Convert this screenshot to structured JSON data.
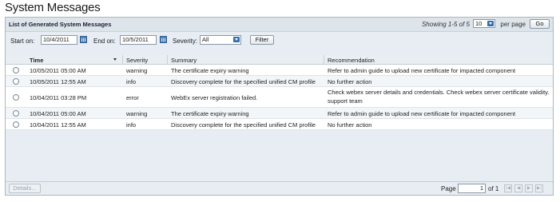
{
  "page": {
    "title": "System Messages"
  },
  "panel": {
    "title": "List of Generated System Messages",
    "showing": "Showing 1-5 of 5",
    "per_page_value": "10",
    "per_page_label": "per page",
    "go_label": "Go"
  },
  "filter": {
    "start_label": "Start on:",
    "start_value": "10/4/2011",
    "end_label": "End on:",
    "end_value": "10/5/2011",
    "severity_label": "Severity:",
    "severity_value": "All",
    "filter_button": "Filter"
  },
  "table": {
    "headers": {
      "time": "Time",
      "severity": "Severity",
      "summary": "Summary",
      "recommendation": "Recommendation"
    },
    "rows": [
      {
        "time": "10/05/2011 05:00 AM",
        "severity": "warning",
        "summary": "The certificate expiry warning",
        "recommendation": "Refer to admin guide to upload new certificate for impacted component"
      },
      {
        "time": "10/05/2011 12:55 AM",
        "severity": "info",
        "summary": "Discovery complete for the specified unified CM profile",
        "recommendation": "No further action"
      },
      {
        "time": "10/04/2011 03:28 PM",
        "severity": "error",
        "summary": "WebEx server registration failed.",
        "recommendation": "Check webex server details and credentials. Check webex server certificate validity. support team"
      },
      {
        "time": "10/04/2011 05:00 AM",
        "severity": "warning",
        "summary": "The certificate expiry warning",
        "recommendation": "Refer to admin guide to upload new certificate for impacted component"
      },
      {
        "time": "10/04/2011 12:55 AM",
        "severity": "info",
        "summary": "Discovery complete for the specified unified CM profile",
        "recommendation": "No further action"
      }
    ]
  },
  "footer": {
    "details_button": "Details...",
    "page_label": "Page",
    "page_value": "1",
    "of_label": "of 1",
    "nav": {
      "first": "|◀",
      "prev": "◀",
      "next": "▶",
      "last": "▶|"
    }
  }
}
